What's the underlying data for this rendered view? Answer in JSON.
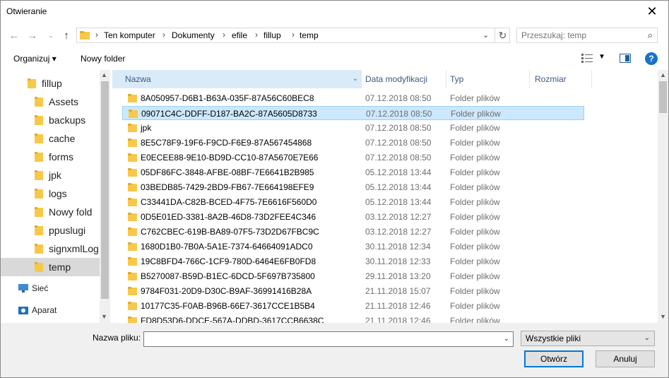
{
  "window": {
    "title": "Otwieranie"
  },
  "address": {
    "crumbs": [
      "Ten komputer",
      "Dokumenty",
      "efile",
      "fillup",
      "temp"
    ]
  },
  "search": {
    "placeholder": "Przeszukaj: temp"
  },
  "toolbar": {
    "organize_label": "Organizuj ▾",
    "new_folder_label": "Nowy folder"
  },
  "nav_tree": {
    "items": [
      {
        "label": "fillup",
        "icon": "folder-icon"
      },
      {
        "label": "Assets",
        "icon": "folder-icon"
      },
      {
        "label": "backups",
        "icon": "folder-icon"
      },
      {
        "label": "cache",
        "icon": "folder-icon"
      },
      {
        "label": "forms",
        "icon": "folder-icon"
      },
      {
        "label": "jpk",
        "icon": "folder-icon"
      },
      {
        "label": "logs",
        "icon": "folder-icon"
      },
      {
        "label": "Nowy fold",
        "icon": "folder-icon"
      },
      {
        "label": "ppuslugi",
        "icon": "folder-icon"
      },
      {
        "label": "signxmlLog",
        "icon": "folder-icon"
      },
      {
        "label": "temp",
        "icon": "folder-icon"
      },
      {
        "label": "Sieć",
        "icon": "network-icon"
      },
      {
        "label": "Aparat",
        "icon": "camera-icon"
      }
    ]
  },
  "columns": {
    "name": "Nazwa",
    "modified": "Data modyfikacji",
    "type": "Typ",
    "size": "Rozmiar"
  },
  "files": [
    {
      "name": "8A050957-D6B1-B63A-035F-87A56C60BEC8",
      "modified": "07.12.2018 08:50",
      "type": "Folder plików"
    },
    {
      "name": "09071C4C-DDFF-D187-BA2C-87A5605D8733",
      "modified": "07.12.2018 08:50",
      "type": "Folder plików"
    },
    {
      "name": "jpk",
      "modified": "07.12.2018 08:50",
      "type": "Folder plików"
    },
    {
      "name": "8E5C78F9-19F6-F9CD-F6E9-87A567454868",
      "modified": "07.12.2018 08:50",
      "type": "Folder plików"
    },
    {
      "name": "E0ECEE88-9E10-BD9D-CC10-87A5670E7E66",
      "modified": "07.12.2018 08:50",
      "type": "Folder plików"
    },
    {
      "name": "05DF86FC-3848-AFBE-08BF-7E6641B2B985",
      "modified": "05.12.2018 13:44",
      "type": "Folder plików"
    },
    {
      "name": "03BEDB85-7429-2BD9-FB67-7E664198EFE9",
      "modified": "05.12.2018 13:44",
      "type": "Folder plików"
    },
    {
      "name": "C33441DA-C82B-BCED-4F75-7E6616F560D0",
      "modified": "05.12.2018 13:44",
      "type": "Folder plików"
    },
    {
      "name": "0D5E01ED-3381-8A2B-46D8-73D2FEE4C346",
      "modified": "03.12.2018 12:27",
      "type": "Folder plików"
    },
    {
      "name": "C762CBEC-619B-BA89-07F5-73D2D67FBC9C",
      "modified": "03.12.2018 12:27",
      "type": "Folder plików"
    },
    {
      "name": "1680D1B0-7B0A-5A1E-7374-64664091ADC0",
      "modified": "30.11.2018 12:34",
      "type": "Folder plików"
    },
    {
      "name": "19C8BFD4-766C-1CF9-780D-6464E6FB0FD8",
      "modified": "30.11.2018 12:33",
      "type": "Folder plików"
    },
    {
      "name": "B5270087-B59D-B1EC-6DCD-5F697B735800",
      "modified": "29.11.2018 13:20",
      "type": "Folder plików"
    },
    {
      "name": "9784F031-20D9-D30C-B9AF-36991416B28A",
      "modified": "21.11.2018 15:07",
      "type": "Folder plików"
    },
    {
      "name": "10177C35-F0AB-B96B-66E7-3617CCE1B5B4",
      "modified": "21.11.2018 12:46",
      "type": "Folder plików"
    },
    {
      "name": "FD8D53D6-DDCE-567A-DDBD-3617CCB6638C",
      "modified": "21.11.2018 12:46",
      "type": "Folder plików"
    }
  ],
  "footer": {
    "filename_label": "Nazwa pliku:",
    "filename_value": "",
    "filter_value": "Wszystkie pliki",
    "open_label": "Otwórz",
    "cancel_label": "Anuluj"
  },
  "colors": {
    "accent": "#0078d7",
    "selection": "#cce8ff",
    "folder": "#f8c84a"
  }
}
